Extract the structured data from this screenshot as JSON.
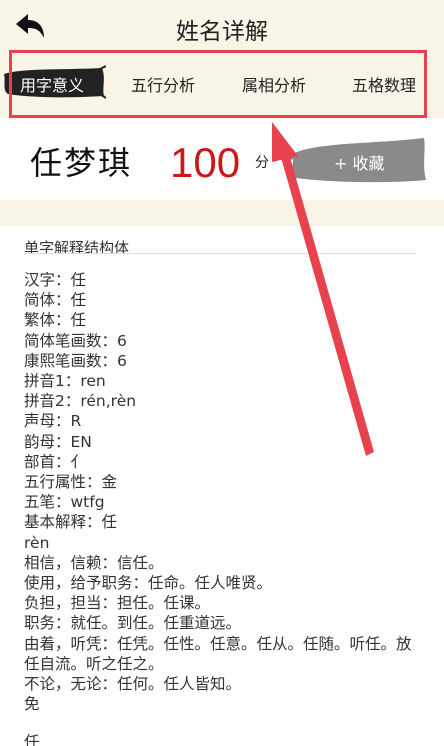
{
  "header": {
    "title": "姓名详解",
    "back_icon": "back-arrow-icon"
  },
  "tabs": [
    {
      "label": "用字意义",
      "active": true
    },
    {
      "label": "五行分析",
      "active": false
    },
    {
      "label": "属相分析",
      "active": false
    },
    {
      "label": "五格数理",
      "active": false
    }
  ],
  "name_card": {
    "name": "任梦琪",
    "score": "100",
    "score_unit": "分",
    "favorite_label": "+ 收藏"
  },
  "section": {
    "title": "单字解释结构体"
  },
  "details": [
    "汉字：任",
    "简体：任",
    "繁体：任",
    "简体笔画数：6",
    "康熙笔画数：6",
    "拼音1：ren",
    "拼音2：rén,rèn",
    "声母：R",
    "韵母：EN",
    "部首：亻",
    "五行属性：金",
    "五笔：wtfg",
    "基本解释：任",
    "rèn",
    "相信，信赖：信任。",
    "使用，给予职务：任命。任人唯贤。",
    "负担，担当：担任。任课。",
    "职务：就任。到任。任重道远。",
    "由着，听凭：任凭。任性。任意。任从。任随。听任。放任自流。听之任之。",
    "不论，无论：任何。任人皆知。",
    "免"
  ],
  "footer_char": "任",
  "colors": {
    "accent_red": "#cc1818",
    "highlight_red": "#e8424e",
    "header_bg": "#f8f5e6"
  }
}
